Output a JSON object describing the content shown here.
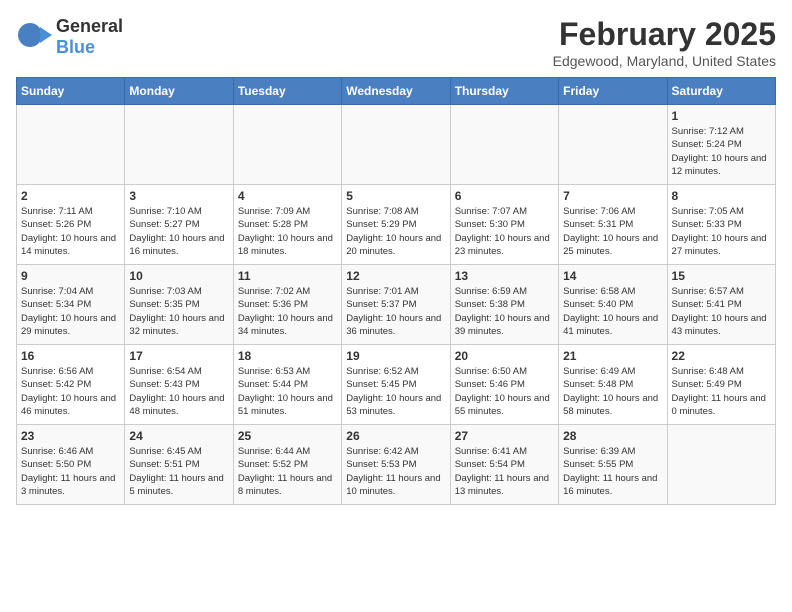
{
  "header": {
    "logo_general": "General",
    "logo_blue": "Blue",
    "month": "February 2025",
    "location": "Edgewood, Maryland, United States"
  },
  "days_of_week": [
    "Sunday",
    "Monday",
    "Tuesday",
    "Wednesday",
    "Thursday",
    "Friday",
    "Saturday"
  ],
  "weeks": [
    [
      {
        "day": "",
        "text": ""
      },
      {
        "day": "",
        "text": ""
      },
      {
        "day": "",
        "text": ""
      },
      {
        "day": "",
        "text": ""
      },
      {
        "day": "",
        "text": ""
      },
      {
        "day": "",
        "text": ""
      },
      {
        "day": "1",
        "text": "Sunrise: 7:12 AM\nSunset: 5:24 PM\nDaylight: 10 hours and 12 minutes."
      }
    ],
    [
      {
        "day": "2",
        "text": "Sunrise: 7:11 AM\nSunset: 5:26 PM\nDaylight: 10 hours and 14 minutes."
      },
      {
        "day": "3",
        "text": "Sunrise: 7:10 AM\nSunset: 5:27 PM\nDaylight: 10 hours and 16 minutes."
      },
      {
        "day": "4",
        "text": "Sunrise: 7:09 AM\nSunset: 5:28 PM\nDaylight: 10 hours and 18 minutes."
      },
      {
        "day": "5",
        "text": "Sunrise: 7:08 AM\nSunset: 5:29 PM\nDaylight: 10 hours and 20 minutes."
      },
      {
        "day": "6",
        "text": "Sunrise: 7:07 AM\nSunset: 5:30 PM\nDaylight: 10 hours and 23 minutes."
      },
      {
        "day": "7",
        "text": "Sunrise: 7:06 AM\nSunset: 5:31 PM\nDaylight: 10 hours and 25 minutes."
      },
      {
        "day": "8",
        "text": "Sunrise: 7:05 AM\nSunset: 5:33 PM\nDaylight: 10 hours and 27 minutes."
      }
    ],
    [
      {
        "day": "9",
        "text": "Sunrise: 7:04 AM\nSunset: 5:34 PM\nDaylight: 10 hours and 29 minutes."
      },
      {
        "day": "10",
        "text": "Sunrise: 7:03 AM\nSunset: 5:35 PM\nDaylight: 10 hours and 32 minutes."
      },
      {
        "day": "11",
        "text": "Sunrise: 7:02 AM\nSunset: 5:36 PM\nDaylight: 10 hours and 34 minutes."
      },
      {
        "day": "12",
        "text": "Sunrise: 7:01 AM\nSunset: 5:37 PM\nDaylight: 10 hours and 36 minutes."
      },
      {
        "day": "13",
        "text": "Sunrise: 6:59 AM\nSunset: 5:38 PM\nDaylight: 10 hours and 39 minutes."
      },
      {
        "day": "14",
        "text": "Sunrise: 6:58 AM\nSunset: 5:40 PM\nDaylight: 10 hours and 41 minutes."
      },
      {
        "day": "15",
        "text": "Sunrise: 6:57 AM\nSunset: 5:41 PM\nDaylight: 10 hours and 43 minutes."
      }
    ],
    [
      {
        "day": "16",
        "text": "Sunrise: 6:56 AM\nSunset: 5:42 PM\nDaylight: 10 hours and 46 minutes."
      },
      {
        "day": "17",
        "text": "Sunrise: 6:54 AM\nSunset: 5:43 PM\nDaylight: 10 hours and 48 minutes."
      },
      {
        "day": "18",
        "text": "Sunrise: 6:53 AM\nSunset: 5:44 PM\nDaylight: 10 hours and 51 minutes."
      },
      {
        "day": "19",
        "text": "Sunrise: 6:52 AM\nSunset: 5:45 PM\nDaylight: 10 hours and 53 minutes."
      },
      {
        "day": "20",
        "text": "Sunrise: 6:50 AM\nSunset: 5:46 PM\nDaylight: 10 hours and 55 minutes."
      },
      {
        "day": "21",
        "text": "Sunrise: 6:49 AM\nSunset: 5:48 PM\nDaylight: 10 hours and 58 minutes."
      },
      {
        "day": "22",
        "text": "Sunrise: 6:48 AM\nSunset: 5:49 PM\nDaylight: 11 hours and 0 minutes."
      }
    ],
    [
      {
        "day": "23",
        "text": "Sunrise: 6:46 AM\nSunset: 5:50 PM\nDaylight: 11 hours and 3 minutes."
      },
      {
        "day": "24",
        "text": "Sunrise: 6:45 AM\nSunset: 5:51 PM\nDaylight: 11 hours and 5 minutes."
      },
      {
        "day": "25",
        "text": "Sunrise: 6:44 AM\nSunset: 5:52 PM\nDaylight: 11 hours and 8 minutes."
      },
      {
        "day": "26",
        "text": "Sunrise: 6:42 AM\nSunset: 5:53 PM\nDaylight: 11 hours and 10 minutes."
      },
      {
        "day": "27",
        "text": "Sunrise: 6:41 AM\nSunset: 5:54 PM\nDaylight: 11 hours and 13 minutes."
      },
      {
        "day": "28",
        "text": "Sunrise: 6:39 AM\nSunset: 5:55 PM\nDaylight: 11 hours and 16 minutes."
      },
      {
        "day": "",
        "text": ""
      }
    ]
  ]
}
